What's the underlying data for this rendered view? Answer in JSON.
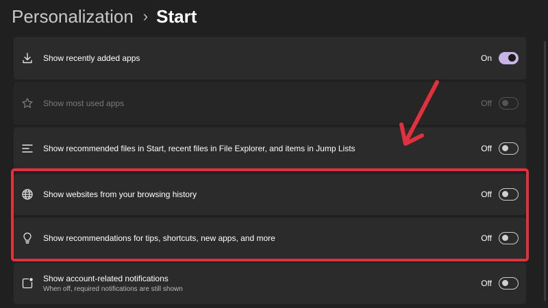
{
  "header": {
    "parent": "Personalization",
    "separator": "›",
    "current": "Start"
  },
  "settings": [
    {
      "label": "Show recently added apps",
      "state": "On",
      "enabled": true,
      "icon": "download-icon"
    },
    {
      "label": "Show most used apps",
      "state": "Off",
      "enabled": false,
      "icon": "star-icon"
    },
    {
      "label": "Show recommended files in Start, recent files in File Explorer, and items in Jump Lists",
      "state": "Off",
      "enabled": true,
      "icon": "list-icon"
    },
    {
      "label": "Show websites from your browsing history",
      "state": "Off",
      "enabled": true,
      "icon": "globe-icon"
    },
    {
      "label": "Show recommendations for tips, shortcuts, new apps, and more",
      "state": "Off",
      "enabled": true,
      "icon": "lightbulb-icon"
    },
    {
      "label": "Show account-related notifications",
      "sublabel": "When off, required notifications are still shown",
      "state": "Off",
      "enabled": true,
      "icon": "notification-icon"
    }
  ],
  "colors": {
    "accent": "#c9b4e6",
    "annotation": "#e2303d",
    "background": "#202020",
    "card": "#2b2b2b"
  }
}
